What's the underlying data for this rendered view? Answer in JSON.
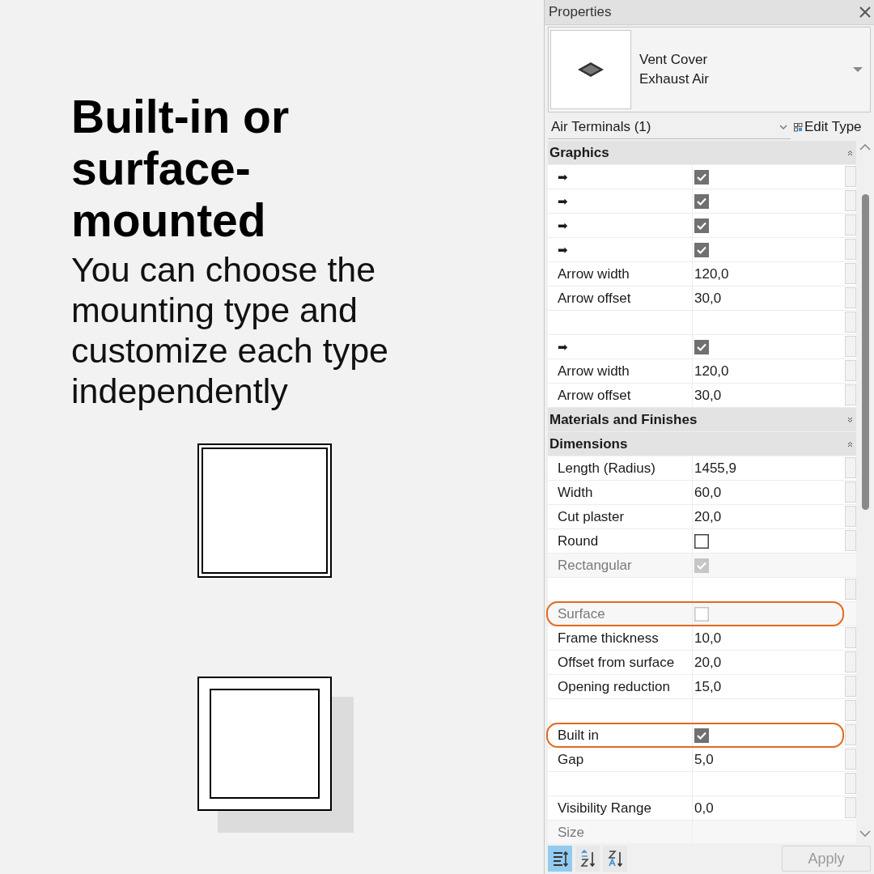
{
  "intro": {
    "heading": "Built-in or surface-mounted",
    "description": "You can choose the mounting type and customize each type independently"
  },
  "properties": {
    "title": "Properties",
    "type_selector": {
      "family": "Vent Cover",
      "type": "Exhaust Air"
    },
    "filter": {
      "value": "Air Terminals (1)",
      "edit_type_label": "Edit Type"
    },
    "sections": [
      {
        "title": "Graphics",
        "expanded": true,
        "rows": [
          {
            "kind": "check",
            "label": "➡",
            "checked": true,
            "disabled": false,
            "highlighted": false,
            "associable": true
          },
          {
            "kind": "check",
            "label": "➡",
            "checked": true,
            "disabled": false,
            "highlighted": false,
            "associable": true
          },
          {
            "kind": "check",
            "label": "➡",
            "checked": true,
            "disabled": false,
            "highlighted": false,
            "associable": true
          },
          {
            "kind": "check",
            "label": "➡",
            "checked": true,
            "disabled": false,
            "highlighted": false,
            "associable": true
          },
          {
            "kind": "text",
            "label": "Arrow width",
            "value": "120,0",
            "disabled": false,
            "highlighted": false,
            "associable": true
          },
          {
            "kind": "text",
            "label": "Arrow offset",
            "value": "30,0",
            "disabled": false,
            "highlighted": false,
            "associable": true
          },
          {
            "kind": "blank",
            "disabled": false,
            "highlighted": false,
            "associable": true
          },
          {
            "kind": "check",
            "label": "➡",
            "checked": true,
            "disabled": false,
            "highlighted": false,
            "associable": true
          },
          {
            "kind": "text",
            "label": "Arrow width",
            "value": "120,0",
            "disabled": false,
            "highlighted": false,
            "associable": true
          },
          {
            "kind": "text",
            "label": "Arrow offset",
            "value": "30,0",
            "disabled": false,
            "highlighted": false,
            "associable": true
          }
        ]
      },
      {
        "title": "Materials and Finishes",
        "expanded": false
      },
      {
        "title": "Dimensions",
        "expanded": true,
        "rows": [
          {
            "kind": "text",
            "label": "Length (Radius)",
            "value": "1455,9",
            "disabled": false,
            "highlighted": false,
            "associable": true
          },
          {
            "kind": "text",
            "label": "Width",
            "value": "60,0",
            "disabled": false,
            "highlighted": false,
            "associable": true
          },
          {
            "kind": "text",
            "label": "Cut plaster",
            "value": "20,0",
            "disabled": false,
            "highlighted": false,
            "associable": true
          },
          {
            "kind": "check",
            "label": "Round",
            "checked": false,
            "disabled": false,
            "highlighted": false,
            "associable": true
          },
          {
            "kind": "check",
            "label": "Rectangular",
            "checked": true,
            "disabled": true,
            "highlighted": false,
            "associable": false
          },
          {
            "kind": "blank",
            "disabled": false,
            "highlighted": false,
            "associable": true
          },
          {
            "kind": "check",
            "label": "Surface",
            "checked": false,
            "disabled": true,
            "highlighted": true,
            "associable": false
          },
          {
            "kind": "text",
            "label": "Frame thickness",
            "value": "10,0",
            "disabled": false,
            "highlighted": false,
            "associable": true
          },
          {
            "kind": "text",
            "label": "Offset from surface",
            "value": "20,0",
            "disabled": false,
            "highlighted": false,
            "associable": true
          },
          {
            "kind": "text",
            "label": "Opening reduction",
            "value": "15,0",
            "disabled": false,
            "highlighted": false,
            "associable": true
          },
          {
            "kind": "blank",
            "disabled": false,
            "highlighted": false,
            "associable": true
          },
          {
            "kind": "check",
            "label": "Built in",
            "checked": true,
            "disabled": false,
            "highlighted": true,
            "associable": true
          },
          {
            "kind": "text",
            "label": "Gap",
            "value": "5,0",
            "disabled": false,
            "highlighted": false,
            "associable": true
          },
          {
            "kind": "blank",
            "disabled": false,
            "highlighted": false,
            "associable": true
          },
          {
            "kind": "text",
            "label": "Visibility Range",
            "value": "0,0",
            "disabled": false,
            "highlighted": false,
            "associable": true
          },
          {
            "kind": "text",
            "label": "Size",
            "disabled": true,
            "highlighted": false,
            "associable": false
          }
        ]
      }
    ],
    "toolbar": [
      {
        "kind": "categorized",
        "selected": true
      },
      {
        "kind": "sort_ascending",
        "selected": false
      },
      {
        "kind": "sort_descending",
        "selected": false
      }
    ],
    "apply_button": {
      "label": "Apply",
      "disabled": true
    }
  }
}
